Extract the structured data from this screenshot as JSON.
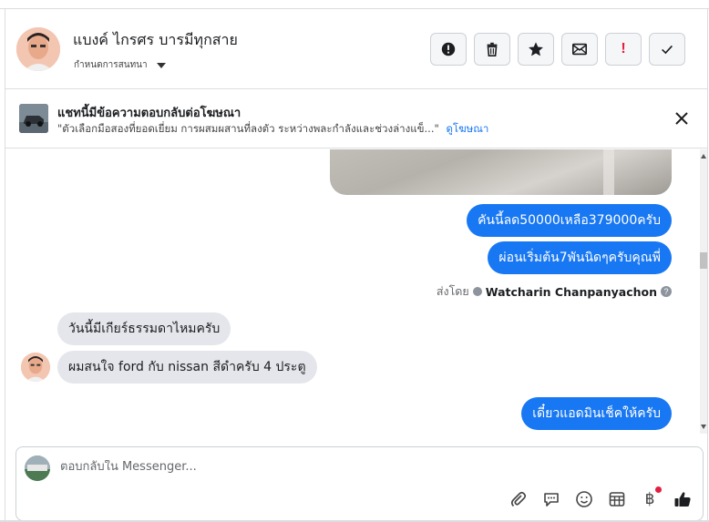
{
  "header": {
    "contact_name": "แบงค์ ไกรศร บารมีทุกสาย",
    "assign_label": "กำหนดการสนทนา",
    "actions": [
      "alert-icon",
      "trash-icon",
      "star-icon",
      "envelope-icon",
      "exclamation-icon",
      "check-icon"
    ],
    "exclamation_glyph": "!"
  },
  "ad_banner": {
    "title": "แชทนี้มีข้อความตอบกลับต่อโฆษณา",
    "description": "\"ตัวเลือกมือสองที่ยอดเยี่ยม การผสมผสานที่ลงตัว ระหว่างพละกำลังและช่วงล่างแข็...\"",
    "link_text": "ดูโฆษณา"
  },
  "messages": {
    "out_1": "คันนี้ลด50000เหลือ379000ครับ",
    "out_2": "ผ่อนเริ่มต้น7พันนิดๆครับคุณพี่",
    "sent_by_prefix": "ส่งโดย",
    "sent_by_agent": "Watcharin Chanpanyachon",
    "help_glyph": "?",
    "in_1": "วันนี้มีเกียร์ธรรมดาไหมครับ",
    "in_2": "ผมสนใจ ford กับ nissan สีดำครับ 4 ประตู",
    "out_3": "เดี๋ยวแอดมินเช็คให้ครับ"
  },
  "composer": {
    "placeholder": "ตอบกลับใน Messenger...",
    "tools": [
      "paperclip-icon",
      "chat-bubble-icon",
      "emoji-icon",
      "table-icon",
      "baht-icon",
      "thumbs-up-icon"
    ],
    "baht_glyph": "฿"
  },
  "colors": {
    "accent": "#1877f2",
    "incoming_bubble": "#e4e6eb",
    "danger": "#e41e3f"
  }
}
